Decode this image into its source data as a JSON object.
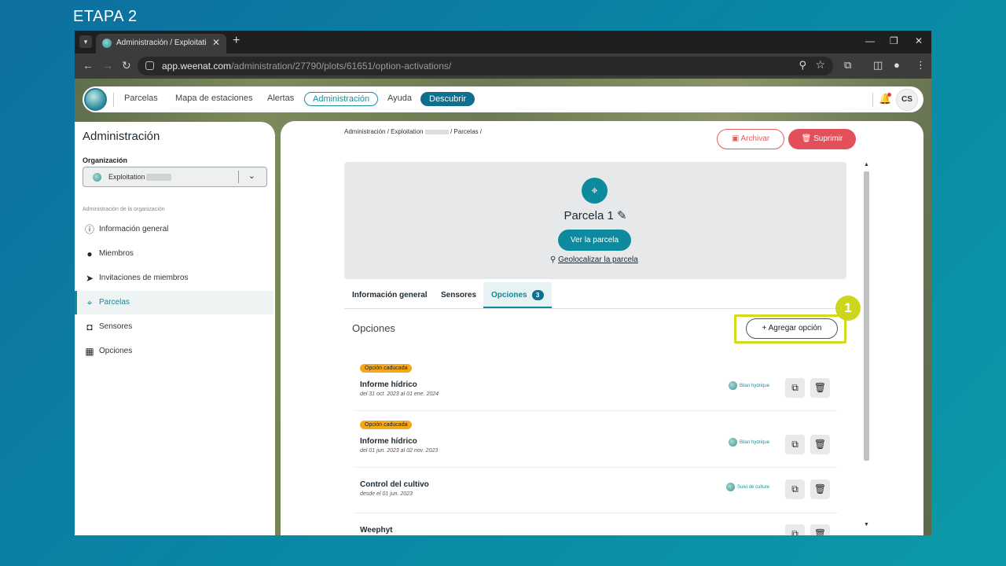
{
  "step_label": "ETAPA 2",
  "browser": {
    "tab_title": "Administración / Exploitation S",
    "url_main": "app.weenat.com",
    "url_path": "/administration/27790/plots/61651/option-activations/"
  },
  "topnav": {
    "items": [
      "Parcelas",
      "Mapa de estaciones",
      "Alertas",
      "Administración",
      "Ayuda"
    ],
    "discover": "Descubrir",
    "avatar": "CS"
  },
  "sidebar": {
    "title": "Administración",
    "org_label": "Organización",
    "org_value": "Exploitation",
    "section": "Administración de la organización",
    "items": [
      {
        "label": "Información general",
        "icon": "info-icon"
      },
      {
        "label": "Miembros",
        "icon": "person-icon"
      },
      {
        "label": "Invitaciones de miembros",
        "icon": "send-icon"
      },
      {
        "label": "Parcelas",
        "icon": "plot-pin-icon"
      },
      {
        "label": "Sensores",
        "icon": "sensor-icon"
      },
      {
        "label": "Opciones",
        "icon": "options-grid-icon"
      }
    ],
    "active": "Parcelas"
  },
  "main": {
    "breadcrumb": [
      "Administración",
      "Exploitation",
      "Parcelas"
    ],
    "archive_label": "Archivar",
    "delete_label": "Suprimir",
    "plot_name": "Parcela 1",
    "view_plot": "Ver la parcela",
    "geolocate": "Geolocalizar la parcela",
    "tabs": {
      "general": "Información general",
      "sensors": "Sensores",
      "options": "Opciones",
      "options_count": "3"
    },
    "options_title": "Opciones",
    "add_option": "Agregar opción",
    "step_number": "1",
    "options": [
      {
        "status": "Opción caducada",
        "name": "Informe hídrico",
        "dates": "del 31 oct. 2023 al 01 ene. 2024",
        "tag": "Bilan hydrique"
      },
      {
        "status": "Opción caducada",
        "name": "Informe hídrico",
        "dates": "del 01 jun. 2023 al 02 nov. 2023",
        "tag": "Bilan hydrique"
      },
      {
        "status": "",
        "name": "Control del cultivo",
        "dates": "desde el 01 jun. 2023",
        "tag": "Suivi de culture"
      },
      {
        "status": "",
        "name": "Weephyt",
        "dates": "",
        "tag": ""
      }
    ]
  },
  "colors": {
    "accent": "#0e8a9e",
    "danger": "#e4505a",
    "expired": "#f5a91a",
    "highlight": "#d3dc1a"
  }
}
